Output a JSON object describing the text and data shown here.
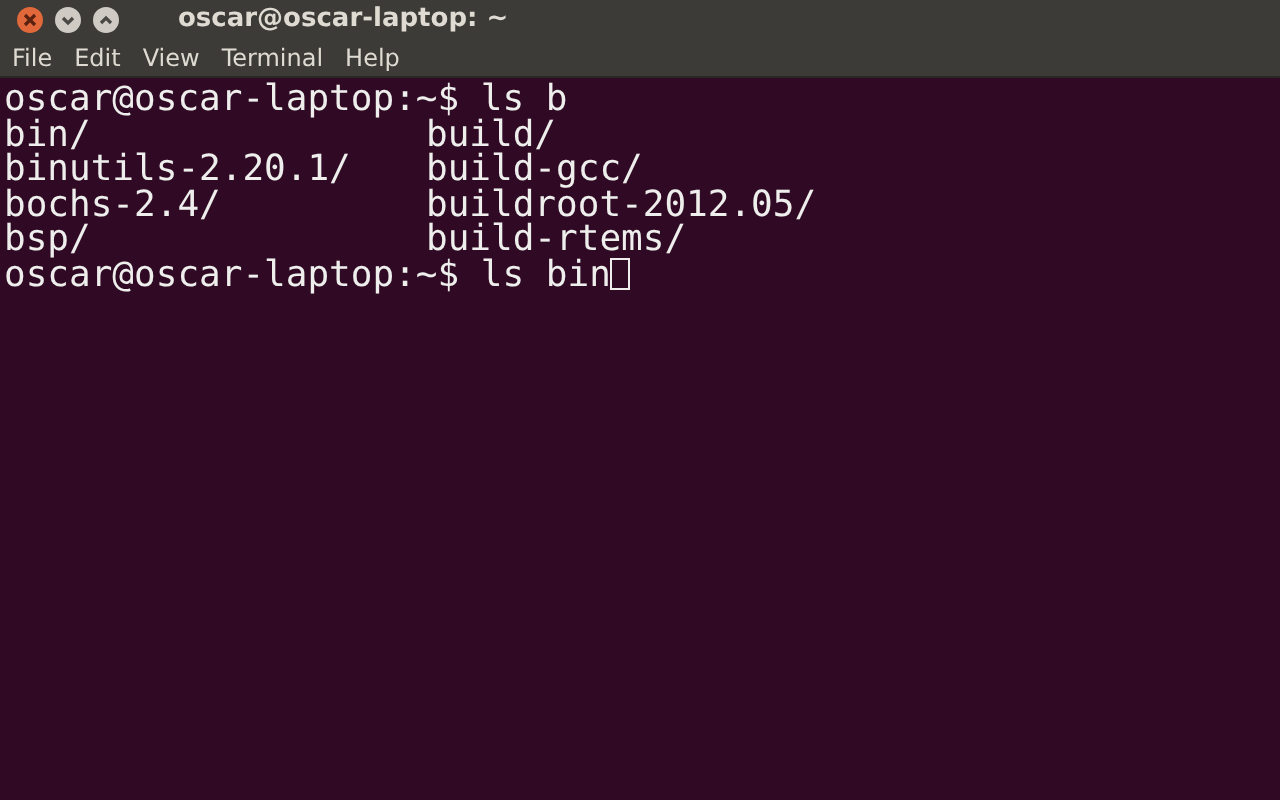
{
  "window": {
    "title": "oscar@oscar-laptop: ~"
  },
  "menu": [
    "File",
    "Edit",
    "View",
    "Terminal",
    "Help"
  ],
  "terminal": {
    "lines": [
      {
        "kind": "prompt",
        "prompt": "oscar@oscar-laptop:~$",
        "command": "ls b",
        "cursor": false
      },
      {
        "kind": "listing",
        "entries": [
          "bin/",
          "build/"
        ]
      },
      {
        "kind": "listing",
        "entries": [
          "binutils-2.20.1/",
          "build-gcc/"
        ]
      },
      {
        "kind": "listing",
        "entries": [
          "bochs-2.4/",
          "buildroot-2012.05/"
        ]
      },
      {
        "kind": "listing",
        "entries": [
          "bsp/",
          "build-rtems/"
        ]
      },
      {
        "kind": "prompt",
        "prompt": "oscar@oscar-laptop:~$",
        "command": "ls bin",
        "cursor": true
      }
    ]
  }
}
